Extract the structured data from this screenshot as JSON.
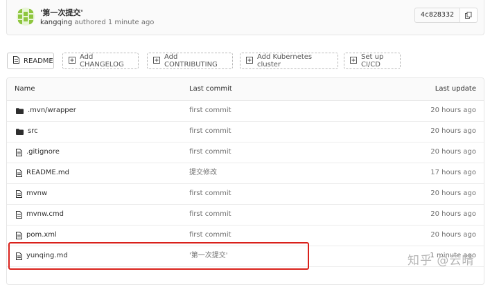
{
  "commit": {
    "title": "'第一次提交'",
    "author": "kangqing",
    "meta_suffix": " authored 1 minute ago",
    "sha": "4c828332"
  },
  "actions": [
    {
      "label": "README",
      "style": "solid",
      "icon": "file-icon"
    },
    {
      "label": "Add CHANGELOG",
      "style": "dashed",
      "icon": "plus-square-icon"
    },
    {
      "label": "Add CONTRIBUTING",
      "style": "dashed",
      "icon": "plus-square-icon"
    },
    {
      "label": "Add Kubernetes cluster",
      "style": "dashed",
      "icon": "plus-square-icon"
    },
    {
      "label": "Set up CI/CD",
      "style": "dashed",
      "icon": "plus-square-icon"
    }
  ],
  "table": {
    "headers": {
      "name": "Name",
      "commit": "Last commit",
      "date": "Last update"
    },
    "rows": [
      {
        "name": ".mvn/wrapper",
        "type": "folder",
        "commit": "first commit",
        "date": "20 hours ago"
      },
      {
        "name": "src",
        "type": "folder",
        "commit": "first commit",
        "date": "20 hours ago"
      },
      {
        "name": ".gitignore",
        "type": "file",
        "commit": "first commit",
        "date": "20 hours ago"
      },
      {
        "name": "README.md",
        "type": "file",
        "commit": "提交修改",
        "date": "17 hours ago"
      },
      {
        "name": "mvnw",
        "type": "file",
        "commit": "first commit",
        "date": "20 hours ago"
      },
      {
        "name": "mvnw.cmd",
        "type": "file",
        "commit": "first commit",
        "date": "20 hours ago"
      },
      {
        "name": "pom.xml",
        "type": "file",
        "commit": "first commit",
        "date": "20 hours ago"
      },
      {
        "name": "yunqing.md",
        "type": "file",
        "commit": "'第一次提交'",
        "date": "1 minute ago"
      }
    ]
  },
  "watermark": "知乎 @云晴",
  "colors": {
    "highlight": "#d9201a",
    "avatar": "#8ec63f"
  }
}
